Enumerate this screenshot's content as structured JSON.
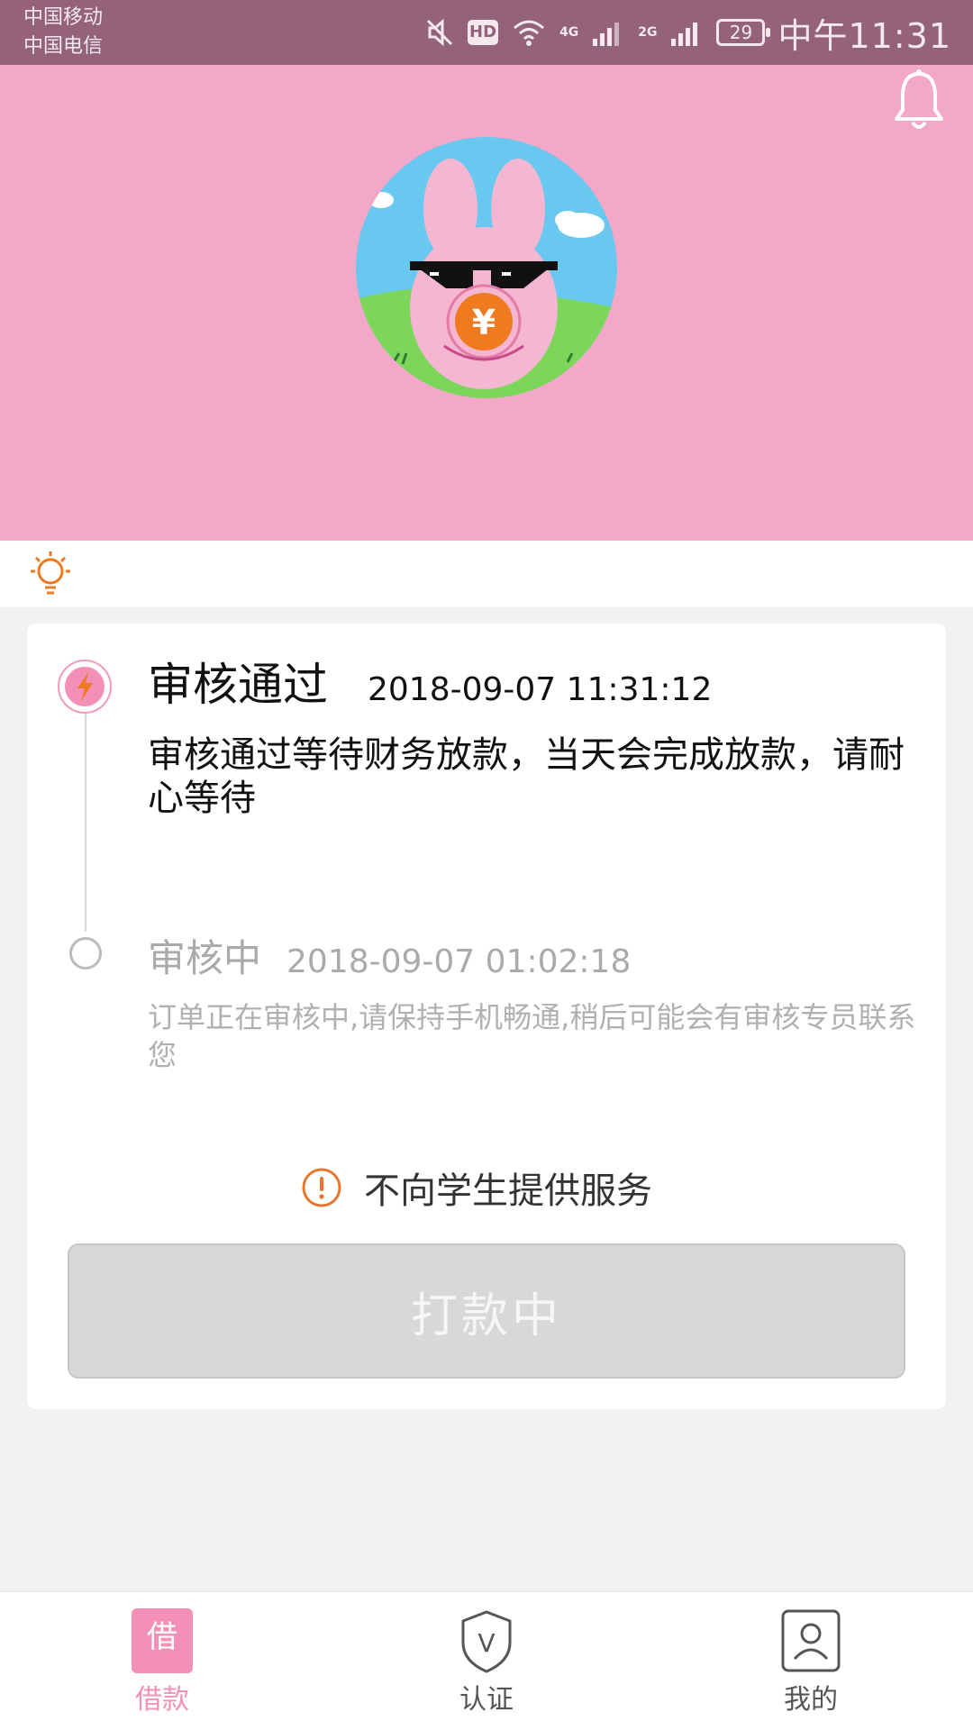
{
  "status_bar": {
    "carrier1": "中国移动",
    "carrier2": "中国电信",
    "hd": "HD",
    "net1": "4G",
    "net2": "2G",
    "battery": "29",
    "time": "中午11:31"
  },
  "header": {
    "bg_color": "#f4a8c8",
    "bell_icon": "bell-icon",
    "avatar_icon": "bunny-coin-avatar",
    "coin_symbol": "¥"
  },
  "tip_row": {
    "icon": "lightbulb-icon"
  },
  "timeline": [
    {
      "title": "审核通过",
      "time": "2018-09-07 11:31:12",
      "desc": "审核通过等待财务放款，当天会完成放款，请耐心等待",
      "active": true
    },
    {
      "title": "审核中",
      "time": "2018-09-07 01:02:18",
      "desc": "订单正在审核中,请保持手机畅通,稍后可能会有审核专员联系您",
      "active": false
    }
  ],
  "notice": {
    "icon": "warning-icon",
    "text": "不向学生提供服务"
  },
  "action_button": {
    "label": "打款中"
  },
  "tabbar": {
    "loan": {
      "icon_text": "借",
      "label": "借款",
      "active": true
    },
    "verify": {
      "icon_text": "V",
      "label": "认证"
    },
    "mine": {
      "label": "我的"
    }
  },
  "colors": {
    "accent": "#f48fb6",
    "status_bar": "#946377",
    "warning": "#e8762e"
  }
}
